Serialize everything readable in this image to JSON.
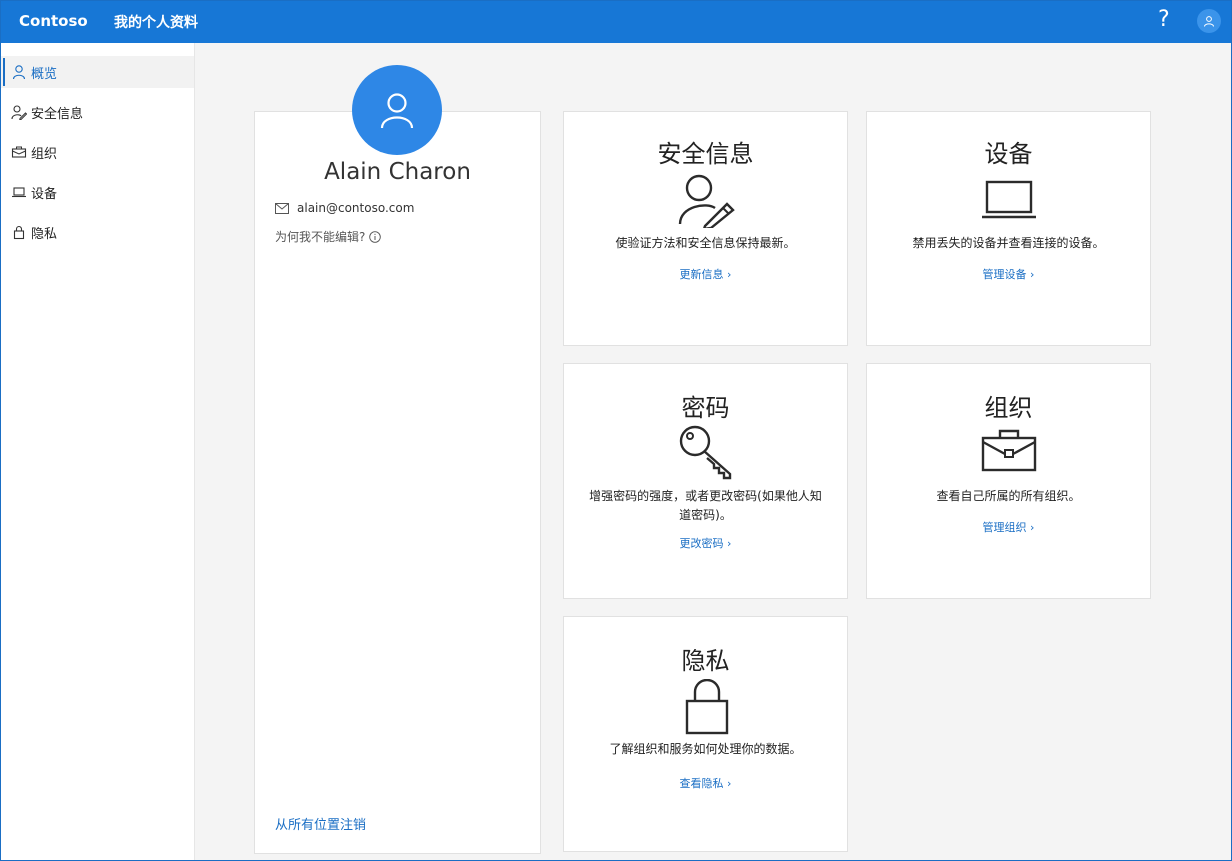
{
  "header": {
    "brand": "Contoso",
    "title": "我的个人资料",
    "help_glyph": "?"
  },
  "sidebar": {
    "items": [
      {
        "label": "概览",
        "icon": "person-icon",
        "active": true
      },
      {
        "label": "安全信息",
        "icon": "person-edit-icon",
        "active": false
      },
      {
        "label": "组织",
        "icon": "briefcase-icon",
        "active": false
      },
      {
        "label": "设备",
        "icon": "laptop-icon",
        "active": false
      },
      {
        "label": "隐私",
        "icon": "lock-icon",
        "active": false
      }
    ]
  },
  "profile": {
    "name": "Alain Charon",
    "email": "alain@contoso.com",
    "why_cant_edit": "为何我不能编辑?",
    "sign_out": "从所有位置注销"
  },
  "cards": {
    "security": {
      "title": "安全信息",
      "icon": "person-edit-icon",
      "desc": "使验证方法和安全信息保持最新。",
      "link": "更新信息"
    },
    "devices": {
      "title": "设备",
      "icon": "laptop-icon",
      "desc": "禁用丢失的设备并查看连接的设备。",
      "link": "管理设备"
    },
    "password": {
      "title": "密码",
      "icon": "key-icon",
      "desc": "增强密码的强度，或者更改密码(如果他人知道密码)。",
      "link": "更改密码"
    },
    "organizations": {
      "title": "组织",
      "icon": "briefcase-icon",
      "desc": "查看自己所属的所有组织。",
      "link": "管理组织"
    },
    "privacy": {
      "title": "隐私",
      "icon": "lock-icon",
      "desc": "了解组织和服务如何处理你的数据。",
      "link": "查看隐私"
    }
  },
  "colors": {
    "accent": "#1777d6",
    "avatar": "#2e87e6",
    "link": "#1a6ec4"
  }
}
